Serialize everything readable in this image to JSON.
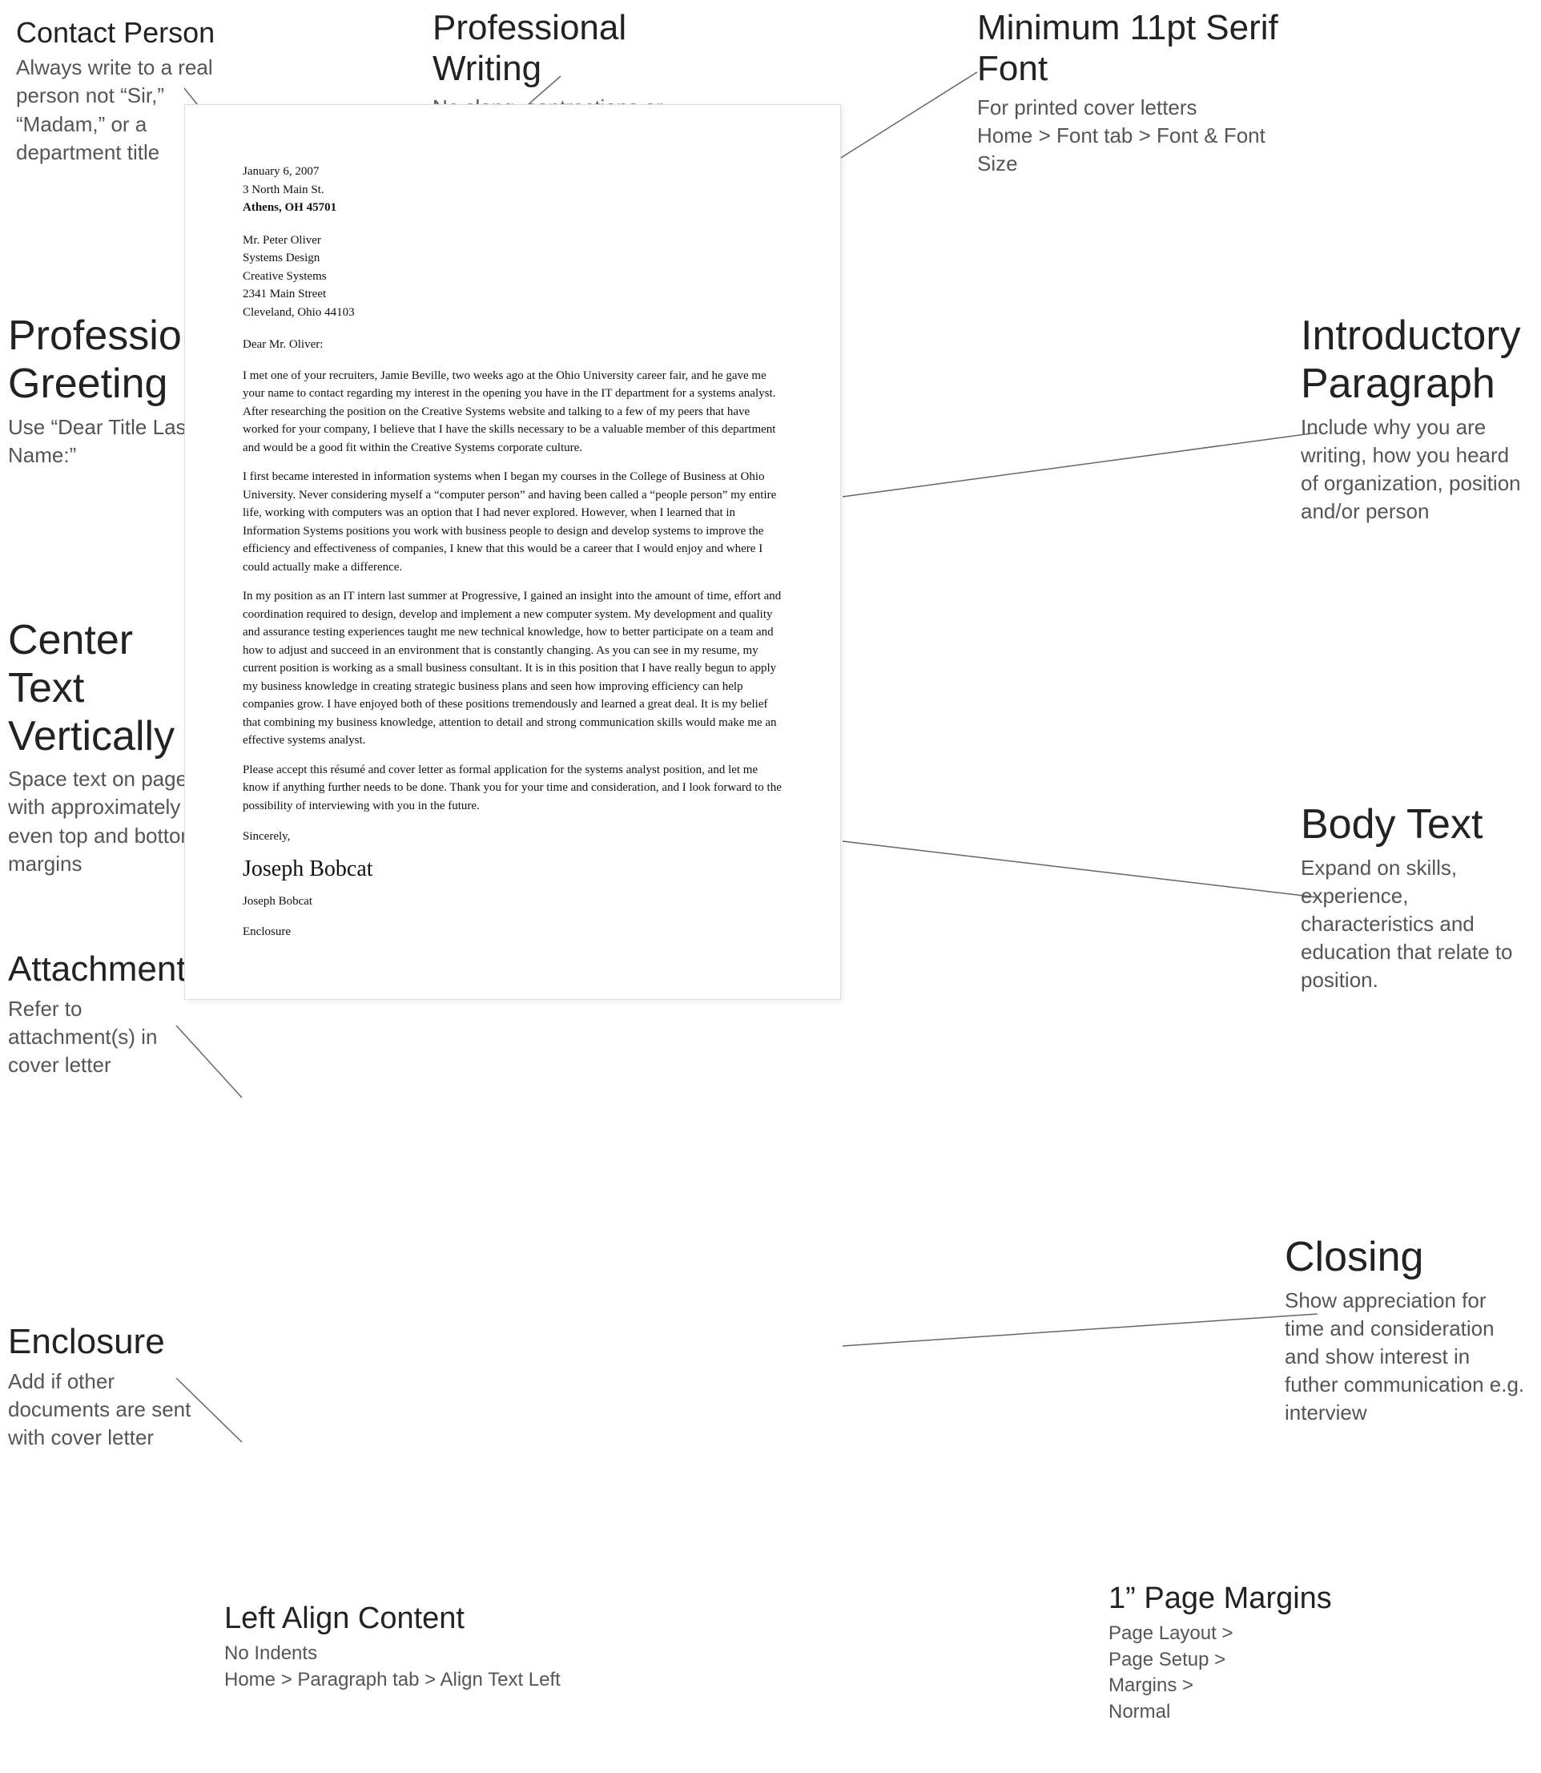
{
  "annotations": {
    "contact": {
      "title": "Contact Person",
      "subtitle": "Always write to a real person not “Sir,” “Madam,” or a department title"
    },
    "professional_writing": {
      "title": "Professional Writing",
      "subtitle": "No slang, contractions or abbreviations (unless used in industry)"
    },
    "min_font": {
      "title": "Minimum 11pt Serif Font",
      "subtitle": "For printed cover letters\nHome > Font tab > Font & Font Size"
    },
    "prof_greeting": {
      "title": "Professional Greeting",
      "subtitle": "Use “Dear Title Last Name:”"
    },
    "center_text": {
      "title": "Center Text Vertically",
      "subtitle": "Space text on page with approximately even top and bottom margins"
    },
    "attachment": {
      "title": "Attachment",
      "subtitle": "Refer to attachment(s) in cover letter"
    },
    "enclosure": {
      "title": "Enclosure",
      "subtitle": "Add if other documents are sent with cover letter"
    },
    "intro_para": {
      "title": "Introductory Paragraph",
      "subtitle": "Include why you are writing, how you heard of organization, position and/or person"
    },
    "body_text": {
      "title": "Body Text",
      "subtitle": "Expand on skills, experience, characteristics and education that relate to position."
    },
    "closing": {
      "title": "Closing",
      "subtitle": "Show appreciation for time and consideration and show interest in futher communication e.g. interview"
    },
    "left_align": {
      "title": "Left Align Content",
      "subtitle": "No Indents\nHome > Paragraph tab > Align Text Left"
    },
    "page_margins": {
      "title": "1” Page Margins",
      "subtitle": "Page Layout >\nPage Setup >\nMargins >\nNormal"
    }
  },
  "letter": {
    "date": "January 6, 2007",
    "sender_address": "3 North Main St.\nAthens, OH 45701",
    "recipient_name": "Mr. Peter Oliver",
    "recipient_title": "Systems Design",
    "recipient_company": "Creative Systems",
    "recipient_street": "2341 Main Street",
    "recipient_city": "Cleveland, Ohio  44103",
    "salutation": "Dear Mr. Oliver:",
    "body_paragraphs": [
      "I met one of your recruiters, Jamie Beville, two weeks ago at the Ohio University career fair, and he gave me your name to contact regarding my interest in the opening you have in the IT department for a systems analyst. After researching the position on the Creative Systems website and talking to a few of my peers that have worked for your company, I believe that I have the skills necessary to be a valuable member of this department and would be a good fit within the Creative Systems corporate culture.",
      "I first became interested in information systems when I began my courses in the College of Business at Ohio University. Never considering myself a “computer person” and having been called a “people person” my entire life, working with computers was an option that I had never explored. However, when I learned that in Information Systems positions you work with business people to design and develop systems to improve the efficiency and effectiveness of companies, I knew that this would be a career that I would enjoy and where I could actually make a difference.",
      "In my position as an IT intern last summer at Progressive, I gained an insight into the amount of time, effort and coordination required to design, develop and implement a new computer system. My development and quality and assurance testing experiences taught me new technical knowledge, how to better participate on a team and how to adjust and succeed in an environment that is constantly changing. As you can see in my resume, my current position is working as a small business consultant. It is in this position that I have really begun to apply my business knowledge in creating strategic business plans and seen how improving efficiency can help companies grow. I have enjoyed both of these positions tremendously and learned a great deal. It is my belief that combining my business knowledge, attention to detail and strong communication skills would make me an effective systems analyst.",
      "Please accept this résumé and cover letter as formal application for the systems analyst position, and let me know if anything further needs to be done. Thank you for your time and consideration, and I look forward to the possibility of interviewing with you in the future."
    ],
    "closing": "Sincerely,",
    "signature": "Joseph Bobcat",
    "name_typed": "Joseph Bobcat",
    "enclosure": "Enclosure"
  }
}
